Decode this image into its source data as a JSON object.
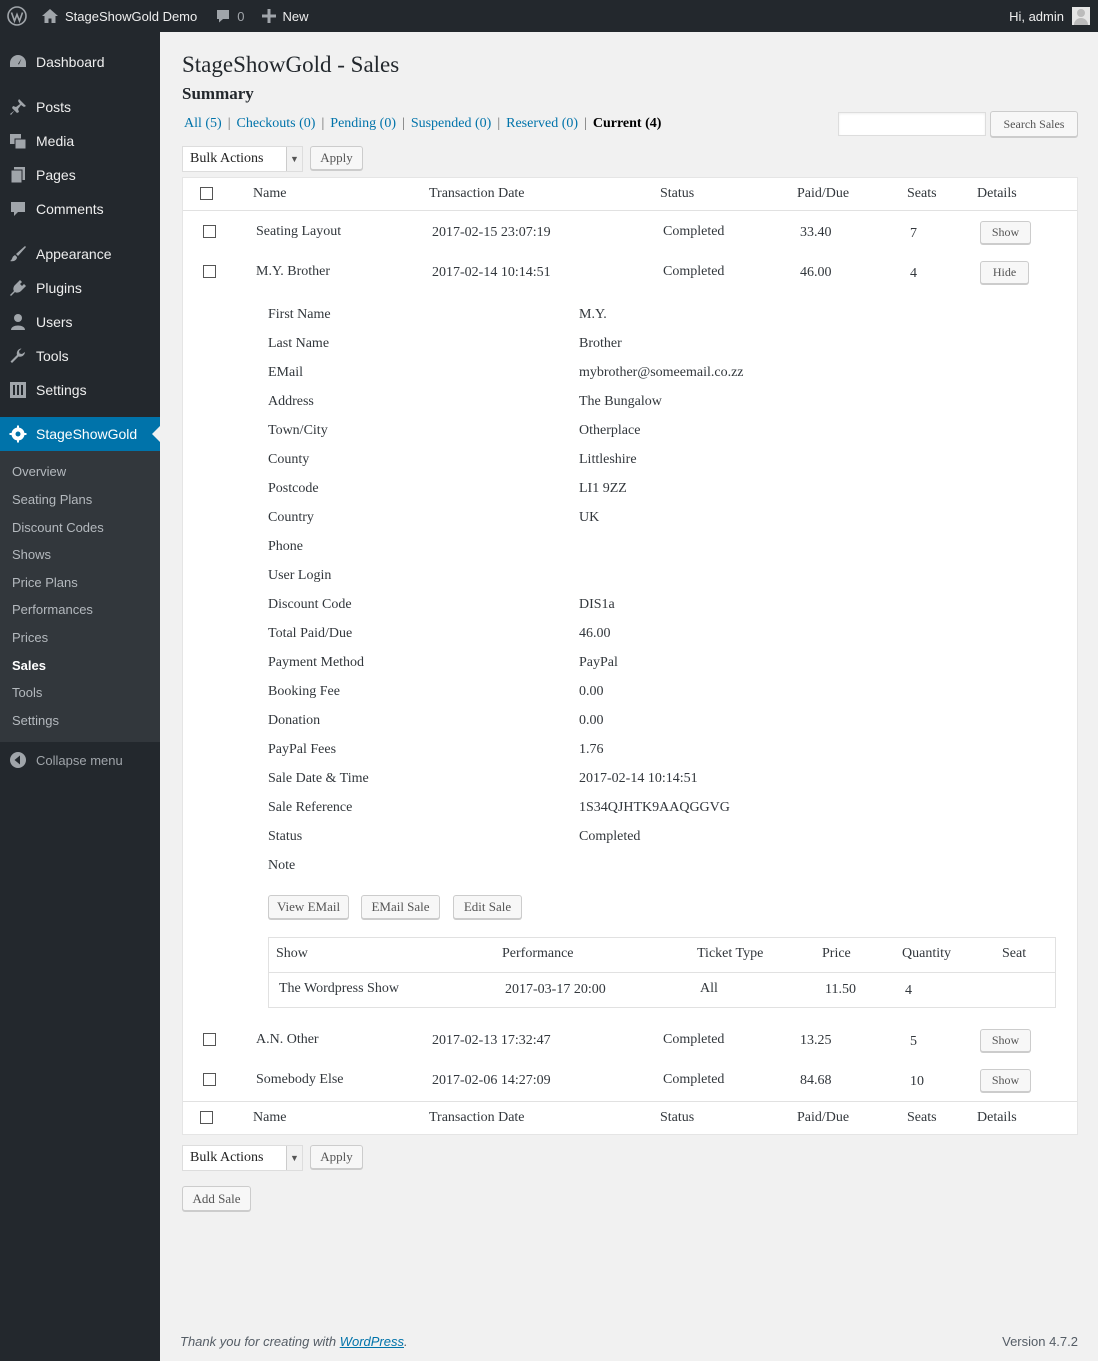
{
  "adminbar": {
    "site_name": "StageShowGold Demo",
    "comments_count": "0",
    "new_label": "New",
    "greeting": "Hi, admin"
  },
  "sidebar": {
    "items": [
      {
        "label": "Dashboard",
        "icon": "dashboard-icon"
      },
      {
        "label": "Posts",
        "icon": "pushpin-icon"
      },
      {
        "label": "Media",
        "icon": "media-icon"
      },
      {
        "label": "Pages",
        "icon": "pages-icon"
      },
      {
        "label": "Comments",
        "icon": "comment-icon"
      },
      {
        "label": "Appearance",
        "icon": "paintbrush-icon"
      },
      {
        "label": "Plugins",
        "icon": "plug-icon"
      },
      {
        "label": "Users",
        "icon": "user-icon"
      },
      {
        "label": "Tools",
        "icon": "wrench-icon"
      },
      {
        "label": "Settings",
        "icon": "settings-icon"
      },
      {
        "label": "StageShowGold",
        "icon": "stageshow-gear-icon"
      }
    ],
    "submenu": [
      "Overview",
      "Seating Plans",
      "Discount Codes",
      "Shows",
      "Price Plans",
      "Performances",
      "Prices",
      "Sales",
      "Tools",
      "Settings"
    ],
    "submenu_current": "Sales",
    "collapse_label": "Collapse menu"
  },
  "page": {
    "title": "StageShowGold - Sales",
    "section": "Summary",
    "filters": {
      "all": "All (5)",
      "checkouts": "Checkouts (0)",
      "pending": "Pending (0)",
      "suspended": "Suspended (0)",
      "reserved": "Reserved (0)",
      "current": "Current (4)"
    },
    "search_button": "Search Sales",
    "search_value": "",
    "bulk_actions": "Bulk Actions",
    "apply_label": "Apply",
    "add_sale_label": "Add Sale"
  },
  "table": {
    "columns": [
      "Name",
      "Transaction Date",
      "Status",
      "Paid/Due",
      "Seats",
      "Details"
    ],
    "rows": [
      {
        "name": "Seating Layout",
        "date": "2017-02-15 23:07:19",
        "status": "Completed",
        "paid": "33.40",
        "seats": "7",
        "action": "Show"
      },
      {
        "name": "M.Y. Brother",
        "date": "2017-02-14 10:14:51",
        "status": "Completed",
        "paid": "46.00",
        "seats": "4",
        "action": "Hide"
      },
      {
        "name": "A.N. Other",
        "date": "2017-02-13 17:32:47",
        "status": "Completed",
        "paid": "13.25",
        "seats": "5",
        "action": "Show"
      },
      {
        "name": "Somebody Else",
        "date": "2017-02-06 14:27:09",
        "status": "Completed",
        "paid": "84.68",
        "seats": "10",
        "action": "Show"
      }
    ]
  },
  "details": {
    "fields": [
      {
        "label": "First Name",
        "value": "M.Y."
      },
      {
        "label": "Last Name",
        "value": "Brother"
      },
      {
        "label": "EMail",
        "value": "mybrother@someemail.co.zz"
      },
      {
        "label": "Address",
        "value": "The Bungalow"
      },
      {
        "label": "Town/City",
        "value": "Otherplace"
      },
      {
        "label": "County",
        "value": "Littleshire"
      },
      {
        "label": "Postcode",
        "value": "LI1 9ZZ"
      },
      {
        "label": "Country",
        "value": "UK"
      },
      {
        "label": "Phone",
        "value": ""
      },
      {
        "label": "User Login",
        "value": ""
      },
      {
        "label": "Discount Code",
        "value": "DIS1a"
      },
      {
        "label": "Total Paid/Due",
        "value": "46.00"
      },
      {
        "label": "Payment Method",
        "value": "PayPal"
      },
      {
        "label": "Booking Fee",
        "value": "0.00"
      },
      {
        "label": "Donation",
        "value": "0.00"
      },
      {
        "label": "PayPal Fees",
        "value": "1.76"
      },
      {
        "label": "Sale Date & Time",
        "value": "2017-02-14 10:14:51"
      },
      {
        "label": "Sale Reference",
        "value": "1S34QJHTK9AAQGGVG"
      },
      {
        "label": "Status",
        "value": "Completed"
      },
      {
        "label": "Note",
        "value": ""
      }
    ],
    "buttons": {
      "view_email": "View EMail",
      "email_sale": "EMail Sale",
      "edit_sale": "Edit Sale"
    },
    "tickets": {
      "columns": [
        "Show",
        "Performance",
        "Ticket Type",
        "Price",
        "Quantity",
        "Seat"
      ],
      "rows": [
        {
          "show": "The Wordpress Show",
          "performance": "2017-03-17 20:00",
          "type": "All",
          "price": "11.50",
          "quantity": "4",
          "seat": ""
        }
      ]
    }
  },
  "footer": {
    "thanks_prefix": "Thank you for creating with ",
    "wordpress_link": "WordPress",
    "thanks_suffix": ".",
    "version": "Version 4.7.2"
  }
}
